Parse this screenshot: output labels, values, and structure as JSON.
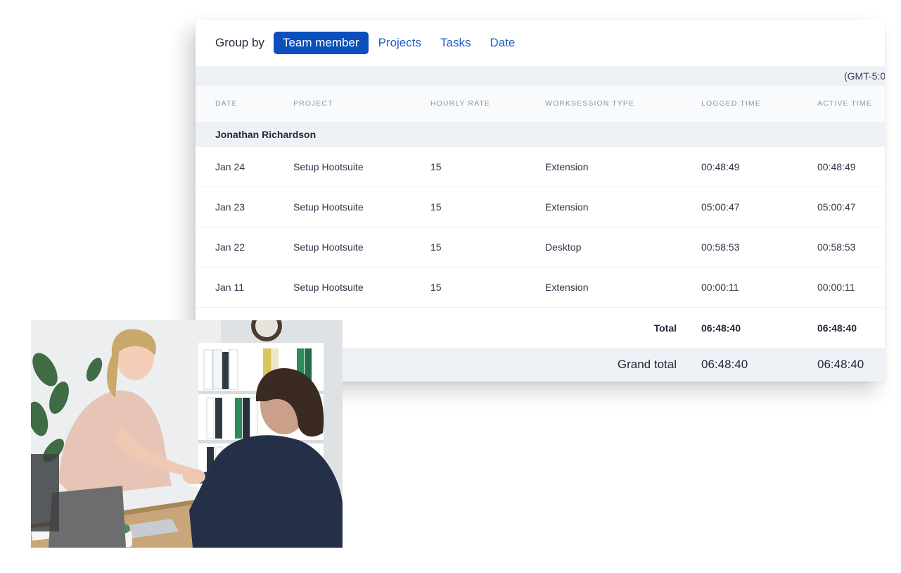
{
  "groupby": {
    "label": "Group by",
    "active": "Team member",
    "options": [
      "Projects",
      "Tasks",
      "Date"
    ]
  },
  "timezone": "(GMT-5:0",
  "columns": [
    "DATE",
    "PROJECT",
    "HOURLY RATE",
    "WORKSESSION TYPE",
    "LOGGED TIME",
    "ACTIVE TIME"
  ],
  "group": {
    "name": "Jonathan Richardson"
  },
  "rows": [
    {
      "date": "Jan 24",
      "project": "Setup Hootsuite",
      "rate": "15",
      "type": "Extension",
      "logged": "00:48:49",
      "active": "00:48:49"
    },
    {
      "date": "Jan 23",
      "project": "Setup Hootsuite",
      "rate": "15",
      "type": "Extension",
      "logged": "05:00:47",
      "active": "05:00:47"
    },
    {
      "date": "Jan 22",
      "project": "Setup Hootsuite",
      "rate": "15",
      "type": "Desktop",
      "logged": "00:58:53",
      "active": "00:58:53"
    },
    {
      "date": "Jan 11",
      "project": "Setup Hootsuite",
      "rate": "15",
      "type": "Extension",
      "logged": "00:00:11",
      "active": "00:00:11"
    }
  ],
  "total": {
    "label": "Total",
    "logged": "06:48:40",
    "active": "06:48:40"
  },
  "grand_total": {
    "label": "Grand total",
    "logged": "06:48:40",
    "active": "06:48:40"
  },
  "colors": {
    "accent": "#0b4fbd",
    "link": "#1f5fc7",
    "band": "#eef2f7"
  }
}
